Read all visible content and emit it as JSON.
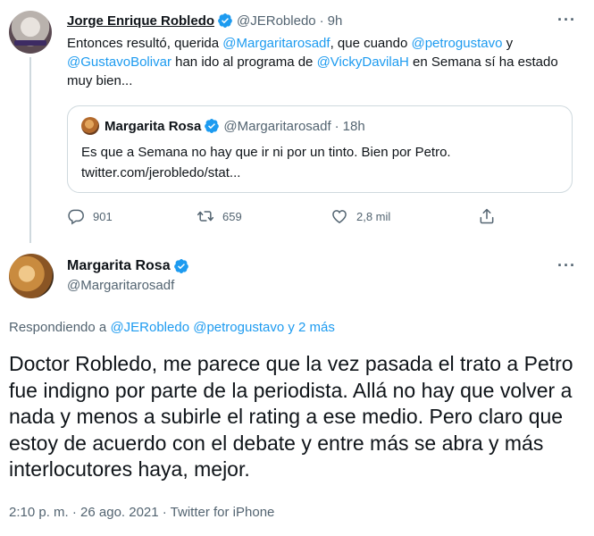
{
  "parent_tweet": {
    "author_name": "Jorge Enrique Robledo",
    "author_handle": "@JERobledo",
    "separator": "·",
    "time": "9h",
    "text_intro": "Entonces resultó, querida ",
    "mention_1": "@Margaritarosadf",
    "text_2": ", que cuando ",
    "mention_2": "@petrogustavo",
    "text_3": " y ",
    "mention_3": "@GustavoBolivar",
    "text_4": " han ido al programa de ",
    "mention_4": "@VickyDavilaH",
    "text_5": " en Semana sí ha estado muy bien...",
    "quote": {
      "author_name": "Margarita Rosa",
      "author_handle": "@Margaritarosadf",
      "separator": "·",
      "time": "18h",
      "text_line1": "Es que a Semana no hay que ir ni por un tinto. Bien por Petro.",
      "text_line2": "twitter.com/jerobledo/stat..."
    },
    "actions": {
      "replies": "901",
      "retweets": "659",
      "likes": "2,8 mil"
    }
  },
  "main_tweet": {
    "author_name": "Margarita Rosa",
    "author_handle": "@Margaritarosadf",
    "reply_prefix": "Respondiendo a ",
    "reply_mentions": "@JERobledo @petrogustavo y 2 más",
    "text": "Doctor Robledo, me parece que la vez pasada el trato a Petro fue indigno por parte de la periodista. Allá no hay que volver a nada y menos a subirle el rating a ese medio. Pero claro que estoy de acuerdo con el debate y entre más se abra y más interlocutores haya, mejor.",
    "metadata": "2:10 p. m. · 26 ago. 2021 · Twitter for iPhone"
  },
  "more_menu": "···",
  "colors": {
    "link": "#1d9bf0",
    "text": "#0f1419",
    "secondary": "#536471",
    "border": "#cfd9de",
    "verified": "#1d9bf0"
  },
  "icons": [
    "reply-icon",
    "retweet-icon",
    "like-icon",
    "share-icon",
    "verified-badge-icon",
    "more-options-icon"
  ]
}
